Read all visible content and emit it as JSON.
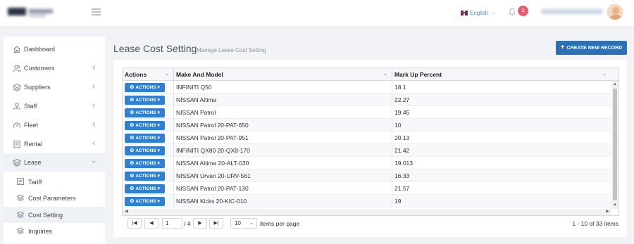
{
  "header": {
    "language": "English",
    "notification_count": "1"
  },
  "sidebar": {
    "items": [
      {
        "label": "Dashboard",
        "icon": "home-icon"
      },
      {
        "label": "Customers",
        "icon": "users-icon"
      },
      {
        "label": "Suppliers",
        "icon": "layers-icon"
      },
      {
        "label": "Staff",
        "icon": "staff-icon"
      },
      {
        "label": "Fleet",
        "icon": "gauge-icon"
      },
      {
        "label": "Rental",
        "icon": "document-icon"
      },
      {
        "label": "Lease",
        "icon": "layers-icon"
      }
    ],
    "lease_sub": [
      {
        "label": "Tariff",
        "icon": "list-icon"
      },
      {
        "label": "Cost Parameters",
        "icon": "layers-icon"
      },
      {
        "label": "Cost Setting",
        "icon": "layers-icon"
      },
      {
        "label": "Inquiries",
        "icon": "layers-icon"
      }
    ]
  },
  "page": {
    "title": "Lease Cost Setting",
    "subtitle": "Manage Lease Cost Setting",
    "create_button": "CREATE NEW RECORD"
  },
  "grid": {
    "columns": [
      "Actions",
      "Make And Model",
      "Mark Up Percent"
    ],
    "action_label": "ACTIONS",
    "rows": [
      {
        "model": "INFINITI Q50",
        "markup": "18.1"
      },
      {
        "model": "NISSAN Altima",
        "markup": "22.27"
      },
      {
        "model": "NISSAN Patrol",
        "markup": "19.45"
      },
      {
        "model": "NISSAN Patrol 20-PAT-650",
        "markup": "10"
      },
      {
        "model": "NISSAN Patrol 20-PAT-951",
        "markup": "20.13"
      },
      {
        "model": "INFINITI QX80 20-QX8-170",
        "markup": "21.42"
      },
      {
        "model": "NISSAN Altima 20-ALT-030",
        "markup": "19.013"
      },
      {
        "model": "NISSAN Urvan 20-URV-561",
        "markup": "16.33"
      },
      {
        "model": "NISSAN Patrol 20-PAT-130",
        "markup": "21.57"
      },
      {
        "model": "NISSAN Kicks 20-KIC-010",
        "markup": "19"
      }
    ]
  },
  "pager": {
    "page": "1",
    "total_pages": "/ 4",
    "page_size": "10",
    "items_per_page": "items per page",
    "info": "1 - 10 of 33 items"
  },
  "colors": {
    "primary": "#2d71b5",
    "action_button": "#2f80d0",
    "badge": "#ef5a6e",
    "link": "#5b87c7"
  }
}
